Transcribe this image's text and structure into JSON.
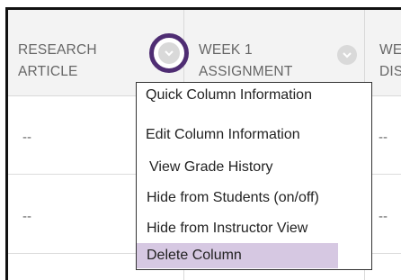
{
  "columns": [
    {
      "header": "RESEARCH\nARTICLE",
      "cells": [
        "--",
        "--"
      ]
    },
    {
      "header": "WEEK 1\nASSIGNMENT",
      "cells": [
        "",
        ""
      ]
    },
    {
      "header": "WE\nDIS",
      "cells": [
        "--",
        "--"
      ]
    }
  ],
  "menu": {
    "items": [
      "Quick Column Information",
      "Edit Column Information",
      "View Grade History",
      "Hide from Students (on/off)",
      "Hide from Instructor View",
      "Delete Column"
    ],
    "highlighted": "Delete Column"
  },
  "colors": {
    "highlight_ring": "#4f2d73",
    "menu_highlight": "#d6c8e2"
  },
  "icons": {
    "column_menu": "chevron-down-icon"
  }
}
